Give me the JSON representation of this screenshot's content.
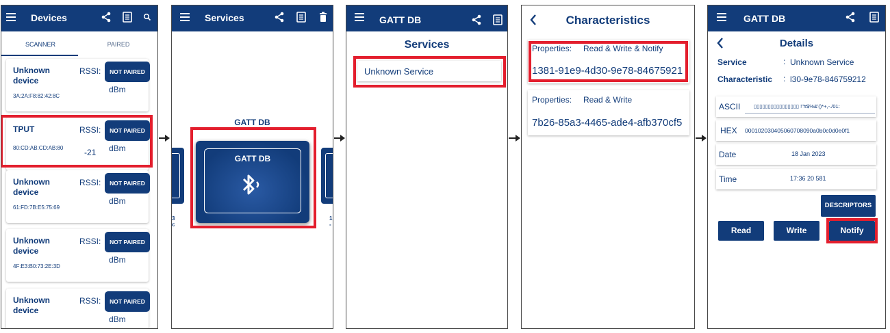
{
  "colors": {
    "primary": "#123c7a",
    "highlight": "#e31e2d"
  },
  "scanner": {
    "title": "Devices",
    "icons": [
      "menu-icon",
      "share-icon",
      "log-icon",
      "search-icon"
    ],
    "tabs": [
      "SCANNER",
      "PAIRED"
    ],
    "rssi_label": "RSSI:",
    "dbm_label": "dBm",
    "button_label": "NOT PAIRED",
    "devices": [
      {
        "name": "Unknown device",
        "mac": "3A:2A:F8:82:42:8C",
        "rssi": ""
      },
      {
        "name": "TPUT",
        "mac": "80:CD:AB:CD:AB:80",
        "rssi": "-21"
      },
      {
        "name": "Unknown device",
        "mac": "61:FD:7B:E5:75:69",
        "rssi": ""
      },
      {
        "name": "Unknown device",
        "mac": "4F:E3:B0:73:2E:3D",
        "rssi": ""
      },
      {
        "name": "Unknown device",
        "mac": "",
        "rssi": ""
      }
    ]
  },
  "services_home": {
    "title": "Services",
    "carousel_caption": "GATT DB",
    "card_label": "GATT DB",
    "left_peek_text": "3\nc",
    "right_peek_text": "1\n-"
  },
  "services_list": {
    "appbar_title": "GATT DB",
    "heading": "Services",
    "items": [
      "Unknown Service"
    ]
  },
  "characteristics": {
    "title": "Characteristics",
    "properties_label": "Properties:",
    "items": [
      {
        "properties": "Read & Write & Notify",
        "uuid": "1381-91e9-4d30-9e78-84675921"
      },
      {
        "properties": "Read & Write",
        "uuid": "7b26-85a3-4465-ade4-afb370cf5"
      }
    ]
  },
  "details": {
    "appbar_title": "GATT DB",
    "title": "Details",
    "service_label": "Service",
    "service_value": "Unknown Service",
    "characteristic_label": "Characteristic",
    "characteristic_value": "l30-9e78-846759212",
    "fields": [
      {
        "label": "ASCII",
        "value": "▯▯▯▯▯▯▯▯▯▯▯▯▯▯▯▯ !\"#$%&'()*+,-./01:"
      },
      {
        "label": "HEX",
        "value": "000102030405060708090a0b0c0d0e0f1"
      },
      {
        "label": "Date",
        "value": "18 Jan 2023"
      },
      {
        "label": "Time",
        "value": "17:36 20 581"
      }
    ],
    "descriptors_label": "DESCRIPTORS",
    "read_label": "Read",
    "write_label": "Write",
    "notify_label": "Notify"
  }
}
